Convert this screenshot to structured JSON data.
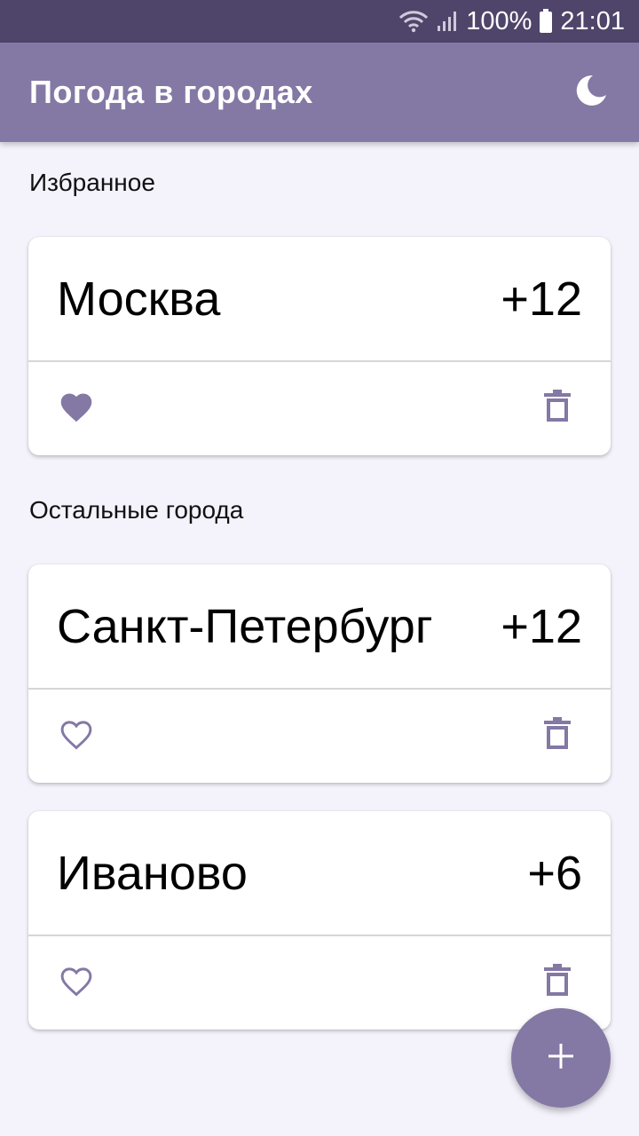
{
  "status_bar": {
    "battery": "100%",
    "time": "21:01",
    "icons": [
      "wifi-icon",
      "signal-icon",
      "battery-icon"
    ]
  },
  "app_bar": {
    "title": "Погода в городах",
    "theme_icon": "moon-icon"
  },
  "sections": {
    "favorites_title": "Избранное",
    "others_title": "Остальные города"
  },
  "cities": [
    {
      "name": "Москва",
      "temp": "+12",
      "favorite": true
    },
    {
      "name": "Санкт-Петербург",
      "temp": "+12",
      "favorite": false
    },
    {
      "name": "Иваново",
      "temp": "+6",
      "favorite": false
    }
  ],
  "fab": {
    "icon": "plus-icon"
  },
  "colors": {
    "accent": "#8478a4",
    "status_bar": "#4f4469",
    "background": "#f4f2fb",
    "icon": "#8478a4"
  }
}
